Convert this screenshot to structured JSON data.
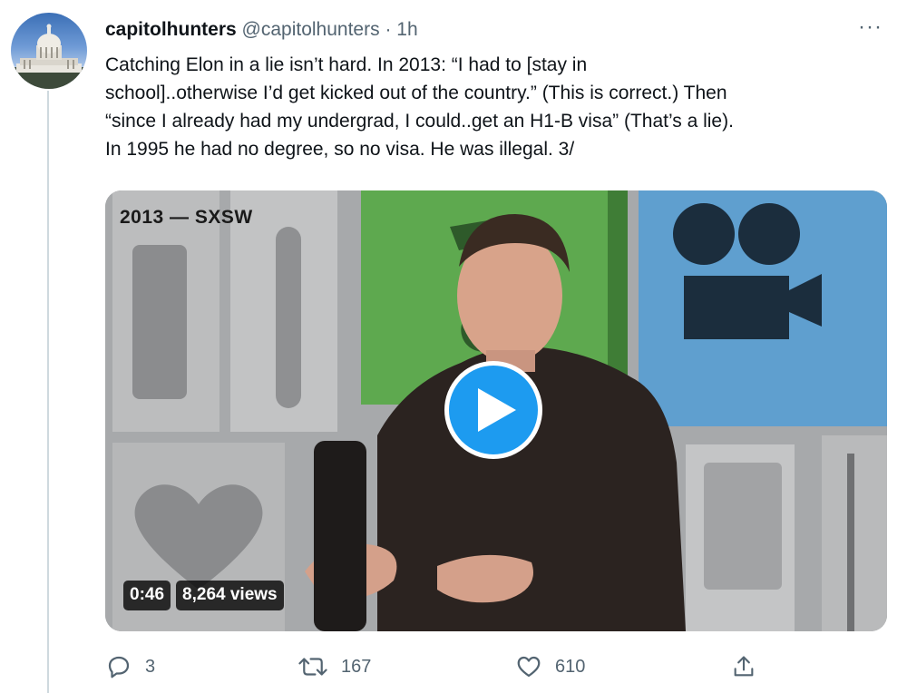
{
  "tweet": {
    "display_name": "capitolhunters",
    "handle": "@capitolhunters",
    "separator": "·",
    "time": "1h",
    "more_label": "···",
    "lines": [
      "Catching Elon in a lie isn’t hard. In 2013: “I had to [stay in",
      "school]..otherwise I’d get kicked out of the country.” (This is correct.) Then",
      "“since I already had my undergrad, I could..get an H1-B visa” (That’s a lie).",
      "In 1995 he had no degree, so no visa. He was illegal. 3/"
    ]
  },
  "video": {
    "caption": "2013 — SXSW",
    "duration": "0:46",
    "views": "8,264 views"
  },
  "actions": {
    "reply_count": "3",
    "retweet_count": "167",
    "like_count": "610"
  },
  "colors": {
    "accent": "#1d9bf0",
    "muted": "#536471",
    "panel_green": "#5ea94f",
    "panel_blue": "#5f9fcf"
  }
}
